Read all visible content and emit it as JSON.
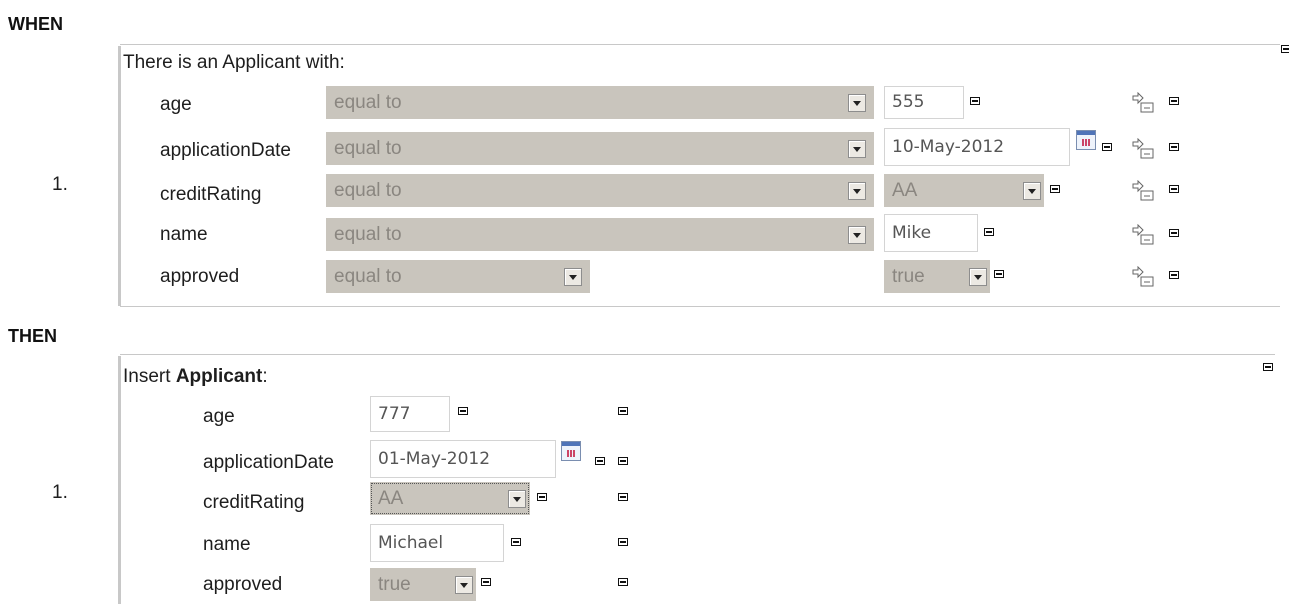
{
  "when": {
    "section_label": "WHEN",
    "row_number": "1.",
    "pattern_header": "There is an Applicant with:",
    "constraints": [
      {
        "field": "age",
        "operator": "equal to",
        "value": "555",
        "value_type": "text"
      },
      {
        "field": "applicationDate",
        "operator": "equal to",
        "value": "10-May-2012",
        "value_type": "date"
      },
      {
        "field": "creditRating",
        "operator": "equal to",
        "value": "AA",
        "value_type": "select"
      },
      {
        "field": "name",
        "operator": "equal to",
        "value": "Mike",
        "value_type": "text"
      },
      {
        "field": "approved",
        "operator": "equal to",
        "value": "true",
        "value_type": "select"
      }
    ]
  },
  "then": {
    "section_label": "THEN",
    "row_number": "1.",
    "action_prefix": "Insert ",
    "action_fact": "Applicant",
    "action_suffix": ":",
    "fields": [
      {
        "field": "age",
        "value": "777",
        "value_type": "text"
      },
      {
        "field": "applicationDate",
        "value": "01-May-2012",
        "value_type": "date"
      },
      {
        "field": "creditRating",
        "value": "AA",
        "value_type": "select"
      },
      {
        "field": "name",
        "value": "Michael",
        "value_type": "text"
      },
      {
        "field": "approved",
        "value": "true",
        "value_type": "select"
      }
    ]
  },
  "icons": {
    "remove": "remove-icon",
    "calendar": "calendar-icon",
    "dropdown": "chevron-down-icon",
    "move": "move-arrow-icon"
  },
  "colors": {
    "select_bg": "#c9c5bd",
    "select_text": "#8a8680",
    "divider": "#c8c8c8"
  }
}
